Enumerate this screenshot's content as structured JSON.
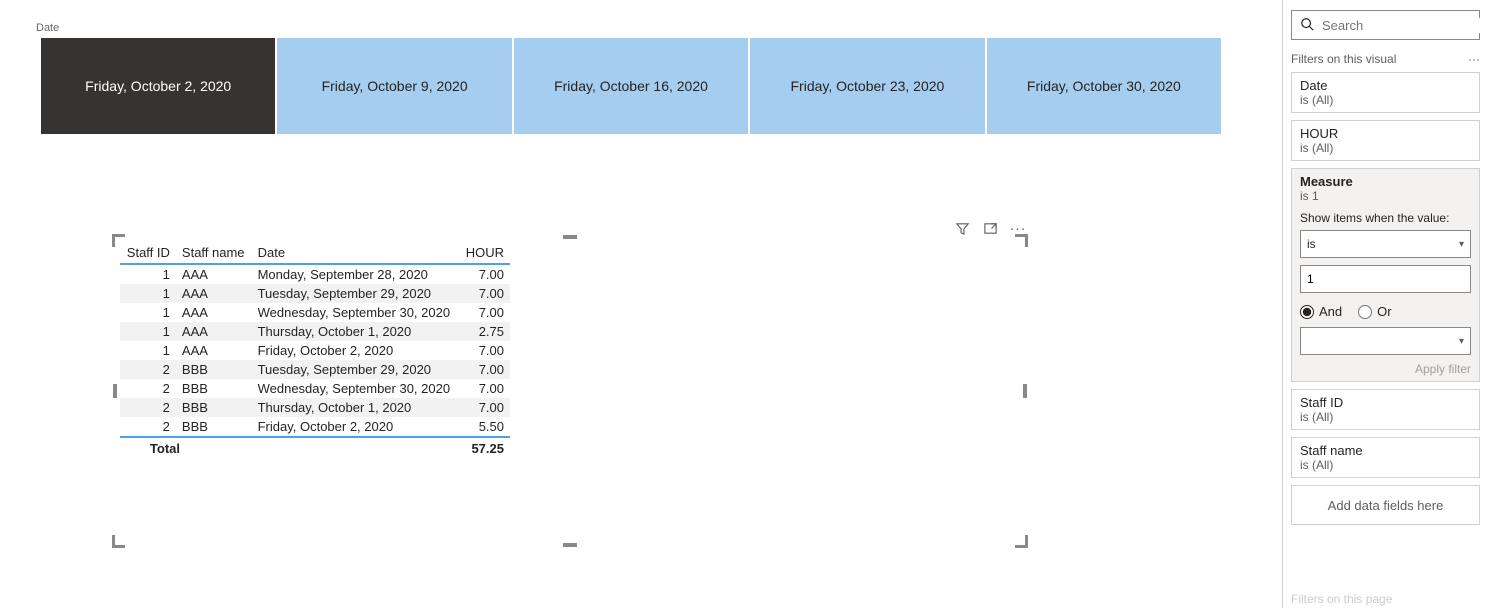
{
  "slicer": {
    "title": "Date",
    "items": [
      {
        "label": "Friday, October 2, 2020",
        "selected": true
      },
      {
        "label": "Friday, October 9, 2020",
        "selected": false
      },
      {
        "label": "Friday, October 16, 2020",
        "selected": false
      },
      {
        "label": "Friday, October 23, 2020",
        "selected": false
      },
      {
        "label": "Friday, October 30, 2020",
        "selected": false
      }
    ]
  },
  "table": {
    "headers": {
      "c0": "Staff ID",
      "c1": "Staff name",
      "c2": "Date",
      "c3": "HOUR"
    },
    "rows": [
      {
        "id": "1",
        "name": "AAA",
        "date": "Monday, September 28, 2020",
        "hour": "7.00"
      },
      {
        "id": "1",
        "name": "AAA",
        "date": "Tuesday, September 29, 2020",
        "hour": "7.00"
      },
      {
        "id": "1",
        "name": "AAA",
        "date": "Wednesday, September 30, 2020",
        "hour": "7.00"
      },
      {
        "id": "1",
        "name": "AAA",
        "date": "Thursday, October 1, 2020",
        "hour": "2.75"
      },
      {
        "id": "1",
        "name": "AAA",
        "date": "Friday, October 2, 2020",
        "hour": "7.00"
      },
      {
        "id": "2",
        "name": "BBB",
        "date": "Tuesday, September 29, 2020",
        "hour": "7.00"
      },
      {
        "id": "2",
        "name": "BBB",
        "date": "Wednesday, September 30, 2020",
        "hour": "7.00"
      },
      {
        "id": "2",
        "name": "BBB",
        "date": "Thursday, October 1, 2020",
        "hour": "7.00"
      },
      {
        "id": "2",
        "name": "BBB",
        "date": "Friday, October 2, 2020",
        "hour": "5.50"
      }
    ],
    "total": {
      "label": "Total",
      "value": "57.25"
    }
  },
  "filters": {
    "search_placeholder": "Search",
    "section_visual": "Filters on this visual",
    "section_page": "Filters on this page",
    "cards": {
      "date": {
        "name": "Date",
        "value": "is (All)"
      },
      "hour": {
        "name": "HOUR",
        "value": "is (All)"
      },
      "measure": {
        "name": "Measure",
        "value": "is 1",
        "prompt": "Show items when the value:",
        "op": "is",
        "val": "1",
        "and": "And",
        "or": "Or",
        "apply": "Apply filter"
      },
      "staffid": {
        "name": "Staff ID",
        "value": "is (All)"
      },
      "staffname": {
        "name": "Staff name",
        "value": "is (All)"
      }
    },
    "dropzone": "Add data fields here"
  }
}
